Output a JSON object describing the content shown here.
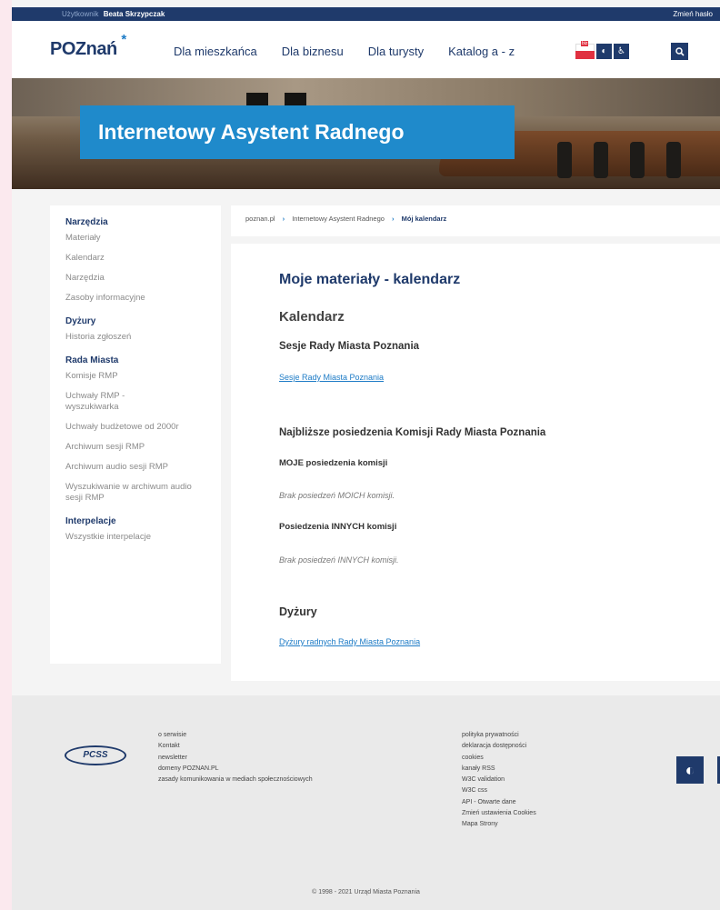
{
  "topbar": {
    "user_label": "Użytkownik",
    "user_name": "Beata Skrzypczak",
    "change_password": "Zmień hasło"
  },
  "header": {
    "logo_text": "POZnań",
    "logo_star": "*",
    "nav": [
      "Dla mieszkańca",
      "Dla biznesu",
      "Dla turysty",
      "Katalog a - z"
    ],
    "flag_tag": "biz",
    "contrast_glyph": "◐",
    "accessibility_glyph": "♿",
    "search_glyph": "🔍"
  },
  "banner": {
    "title": "Internetowy Asystent Radnego"
  },
  "sidebar": {
    "sections": [
      {
        "title": "Narzędzia",
        "items": [
          "Materiały",
          "Kalendarz",
          "Narzędzia",
          "Zasoby informacyjne"
        ]
      },
      {
        "title": "Dyżury",
        "items": [
          "Historia zgłoszeń"
        ]
      },
      {
        "title": "Rada Miasta",
        "items": [
          "Komisje RMP",
          "Uchwały RMP - wyszukiwarka",
          "Uchwały budżetowe od 2000r",
          "Archiwum sesji RMP",
          "Archiwum audio sesji RMP",
          "Wyszukiwanie w archiwum audio sesji RMP"
        ]
      },
      {
        "title": "Interpelacje",
        "items": [
          "Wszystkie interpelacje"
        ]
      }
    ]
  },
  "breadcrumb": {
    "home": "poznan.pl",
    "section": "Internetowy Asystent Radnego",
    "current": "Mój kalendarz",
    "sep": "›"
  },
  "main": {
    "title": "Moje materiały - kalendarz",
    "subtitle": "Kalendarz",
    "sessions_heading": "Sesje Rady Miasta Poznania",
    "sessions_link": "Sesje Rady Miasta Poznania",
    "committees_heading": "Najbliższe posiedzenia Komisji Rady Miasta Poznania",
    "my_committees_heading": "MOJE posiedzenia komisji",
    "my_committees_note": "Brak posiedzeń MOICH komisji.",
    "other_committees_heading": "Posiedzenia INNYCH komisji",
    "other_committees_note": "Brak posiedzeń INNYCH komisji.",
    "duty_heading": "Dyżury",
    "duty_link": "Dyżury radnych Rady Miasta Poznania"
  },
  "footer": {
    "logo": "PCSS",
    "col1": [
      "o serwisie",
      "Kontakt",
      "newsletter",
      "domeny POZNAN.PL",
      "zasady komunikowania w mediach społecznościowych"
    ],
    "col2": [
      "polityka prywatności",
      "deklaracja dostępności",
      "cookies",
      "kanały RSS",
      "W3C validation",
      "W3C css",
      "API - Otwarte dane",
      "Zmień ustawienia Cookies",
      "Mapa Strony"
    ],
    "contrast_glyph": "◐",
    "copyright": "© 1998 - 2021 Urząd Miasta Poznania"
  },
  "colors": {
    "navy": "#1f3a6b",
    "accent": "#1f8acb",
    "link": "#1d7bc6"
  }
}
